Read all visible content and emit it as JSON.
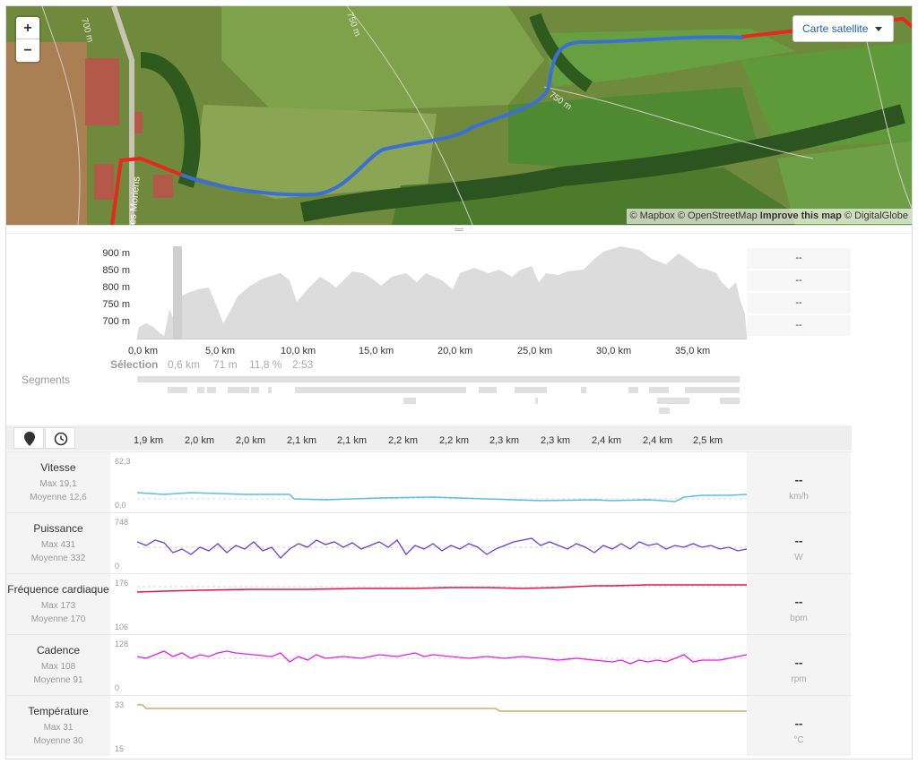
{
  "map": {
    "zoom_in": "+",
    "zoom_out": "−",
    "layer_button": "Carte satellite",
    "attribution_mapbox": "© Mapbox",
    "attribution_osm": "© OpenStreetMap",
    "attribution_improve": "Improve this map",
    "attribution_dg": "© DigitalGlobe",
    "contour_labels": [
      "700 m",
      "750 m",
      "750 m"
    ],
    "street_label": "es Moriens",
    "colors": {
      "route_selected": "#3a6fd8",
      "route": "#e8271f"
    }
  },
  "elevation": {
    "y_ticks": [
      "900 m",
      "850 m",
      "800 m",
      "750 m",
      "700 m"
    ],
    "x_ticks": [
      "0,0 km",
      "5,0 km",
      "10,0 km",
      "15,0 km",
      "20,0 km",
      "25,0 km",
      "30,0 km",
      "35,0 km"
    ],
    "side_values": [
      "--",
      "--",
      "--",
      "--"
    ],
    "selection": {
      "label": "Sélection",
      "distance": "0,6 km",
      "elevation": "71 m",
      "grade": "11,8 %",
      "time": "2:53"
    },
    "segments_label": "Segments"
  },
  "timeline": {
    "tabs": [
      "map-pin-icon",
      "clock-icon"
    ],
    "ticks": [
      "1,9 km",
      "2,0 km",
      "2,0 km",
      "2,1 km",
      "2,1 km",
      "2,2 km",
      "2,2 km",
      "2,3 km",
      "2,3 km",
      "2,4 km",
      "2,4 km",
      "2,5 km"
    ]
  },
  "metrics": [
    {
      "name": "Vitesse",
      "max": "Max 19,1",
      "avg": "Moyenne 12,6",
      "ymax": "62,3",
      "ymin": "0,0",
      "value": "--",
      "unit": "km/h",
      "color": "#5bbde8"
    },
    {
      "name": "Puissance",
      "max": "Max 431",
      "avg": "Moyenne 332",
      "ymax": "748",
      "ymin": "0",
      "value": "--",
      "unit": "W",
      "color": "#6a3fd6"
    },
    {
      "name": "Fréquence cardiaque",
      "max": "Max 173",
      "avg": "Moyenne 170",
      "ymax": "176",
      "ymin": "106",
      "value": "--",
      "unit": "bpm",
      "color": "#e0174a"
    },
    {
      "name": "Cadence",
      "max": "Max 108",
      "avg": "Moyenne 91",
      "ymax": "128",
      "ymin": "0",
      "value": "--",
      "unit": "rpm",
      "color": "#e61ee6"
    },
    {
      "name": "Température",
      "max": "Max 31",
      "avg": "Moyenne 30",
      "ymax": "33",
      "ymin": "15",
      "value": "--",
      "unit": "°C",
      "color": "#c9b06a"
    }
  ]
}
